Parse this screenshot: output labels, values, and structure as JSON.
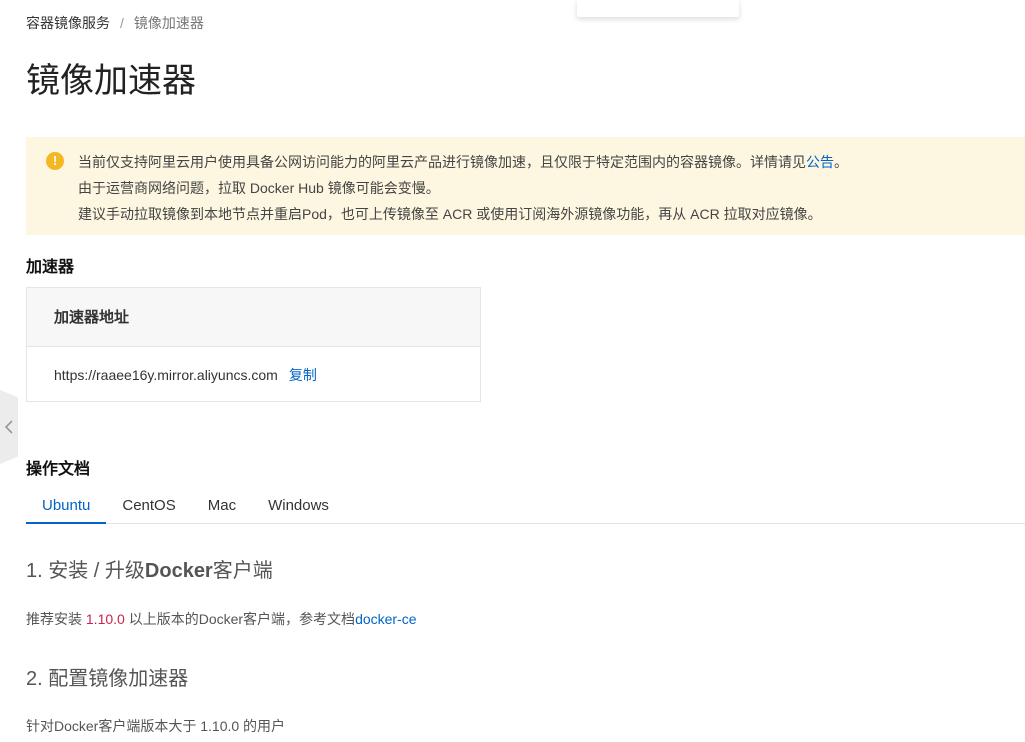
{
  "breadcrumb": {
    "parent": "容器镜像服务",
    "separator": "/",
    "current": "镜像加速器"
  },
  "page": {
    "title": "镜像加速器"
  },
  "notice": {
    "line1_text": "当前仅支持阿里云用户使用具备公网访问能力的阿里云产品进行镜像加速，且仅限于特定范围内的容器镜像。详情请见",
    "line1_link": "公告",
    "line1_end": "。",
    "line2": "由于运营商网络问题，拉取 Docker Hub 镜像可能会变慢。",
    "line3": "建议手动拉取镜像到本地节点并重启Pod，也可上传镜像至 ACR 或使用订阅海外源镜像功能，再从 ACR 拉取对应镜像。",
    "icon": "warning-icon",
    "color": "#f5b723"
  },
  "accelerator": {
    "section_title": "加速器",
    "header": "加速器地址",
    "address": "https://raaee16y.mirror.aliyuncs.com",
    "copy_label": "复制"
  },
  "docs": {
    "section_title": "操作文档",
    "tabs": [
      {
        "label": "Ubuntu",
        "active": true
      },
      {
        "label": "CentOS",
        "active": false
      },
      {
        "label": "Mac",
        "active": false
      },
      {
        "label": "Windows",
        "active": false
      }
    ],
    "step1": {
      "prefix": "1. 安装 / 升级",
      "bold": "Docker",
      "suffix": "客户端"
    },
    "step1_desc": {
      "prefix": "推荐安装 ",
      "version": "1.10.0",
      "middle": " 以上版本的Docker客户端，参考文档",
      "link": "docker-ce"
    },
    "step2": {
      "title": "2. 配置镜像加速器"
    },
    "step2_desc": "针对Docker客户端版本大于 1.10.0 的用户"
  },
  "colors": {
    "accent": "#0064c8",
    "notice_bg": "#fdf6e0",
    "code": "#c7254e"
  }
}
